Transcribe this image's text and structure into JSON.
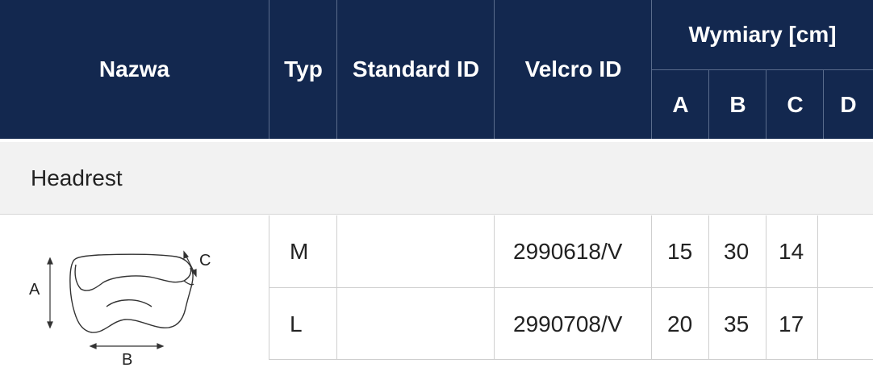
{
  "header": {
    "name": "Nazwa",
    "type": "Typ",
    "standard_id": "Standard ID",
    "velcro_id": "Velcro ID",
    "dimensions": "Wymiary [cm]",
    "dim_a": "A",
    "dim_b": "B",
    "dim_c": "C",
    "dim_d": "D"
  },
  "section": {
    "label": "Headrest"
  },
  "diagram": {
    "label_a": "A",
    "label_b": "B",
    "label_c": "C"
  },
  "rows": [
    {
      "type": "M",
      "standard_id": "",
      "velcro_id": "2990618/V",
      "a": "15",
      "b": "30",
      "c": "14",
      "d": ""
    },
    {
      "type": "L",
      "standard_id": "",
      "velcro_id": "2990708/V",
      "a": "20",
      "b": "35",
      "c": "17",
      "d": ""
    }
  ],
  "colors": {
    "header_bg": "#13284f",
    "section_bg": "#f2f2f2",
    "grid": "#cfcfcf"
  }
}
